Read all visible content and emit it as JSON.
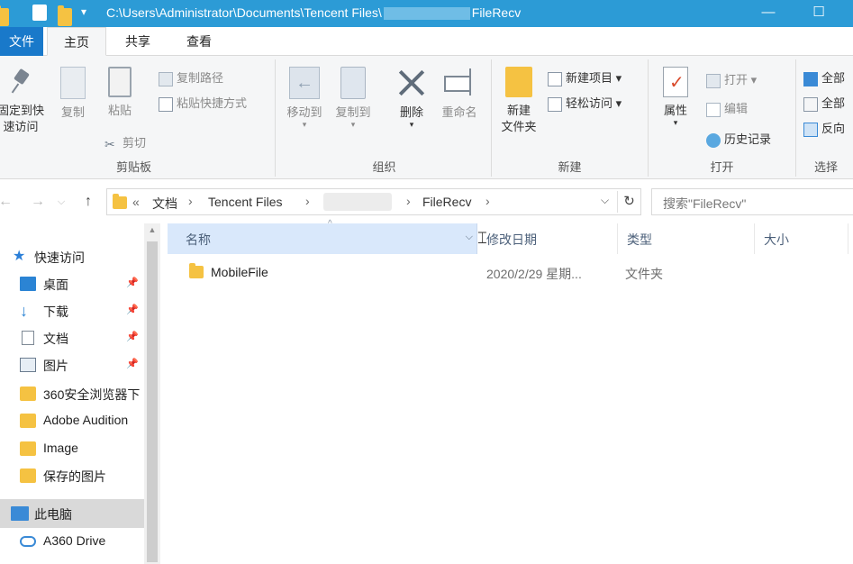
{
  "window": {
    "path_start": "C:\\Users\\Administrator\\Documents\\Tencent Files\\",
    "path_end": "FileRecv",
    "minimize_glyph": "—",
    "maximize_glyph": "☐"
  },
  "tabs": {
    "file": "文件",
    "home": "主页",
    "share": "共享",
    "view": "查看"
  },
  "ribbon": {
    "clipboard": {
      "group_label": "剪贴板",
      "pin_line1": "固定到快",
      "pin_line2": "速访问",
      "copy": "复制",
      "paste": "粘贴",
      "copy_path": "复制路径",
      "paste_shortcut": "粘贴快捷方式",
      "cut": "剪切"
    },
    "organize": {
      "group_label": "组织",
      "move_to": "移动到",
      "copy_to": "复制到",
      "delete": "删除",
      "rename": "重命名"
    },
    "new": {
      "group_label": "新建",
      "new_folder_line1": "新建",
      "new_folder_line2": "文件夹",
      "new_item": "新建项目 ▾",
      "easy_access": "轻松访问 ▾"
    },
    "open": {
      "group_label": "打开",
      "properties": "属性",
      "open": "打开 ▾",
      "edit": "编辑",
      "history": "历史记录"
    },
    "select": {
      "group_label": "选择",
      "select_all": "全部",
      "select_none": "全部",
      "invert": "反向"
    }
  },
  "address": {
    "back": "←",
    "forward": "→",
    "up": "↑",
    "overflow": "«",
    "crumbs": [
      "文档",
      "Tencent Files",
      "FileRecv"
    ],
    "separator": "›",
    "dropdown": "⌵",
    "refresh": "↻",
    "search_placeholder": "搜索\"FileRecv\""
  },
  "nav": {
    "quick_access": "快速访问",
    "items": [
      "桌面",
      "下载",
      "文档",
      "图片",
      "360安全浏览器下",
      "Adobe Audition",
      "Image",
      "保存的图片"
    ],
    "pin_glyph": "📌",
    "this_pc": "此电脑",
    "a360": "A360 Drive"
  },
  "columns": {
    "name": "名称",
    "date": "修改日期",
    "type": "类型",
    "size": "大小",
    "sort_glyph": "^",
    "dropdown_glyph": "⌵"
  },
  "files": [
    {
      "name": "MobileFile",
      "date": "2020/2/29 星期...",
      "type": "文件夹"
    }
  ],
  "colors": {
    "titlebar": "#2c9bd6",
    "file_tab": "#1979ca",
    "folder": "#f5c242",
    "selected_header": "#d9e8fb"
  }
}
